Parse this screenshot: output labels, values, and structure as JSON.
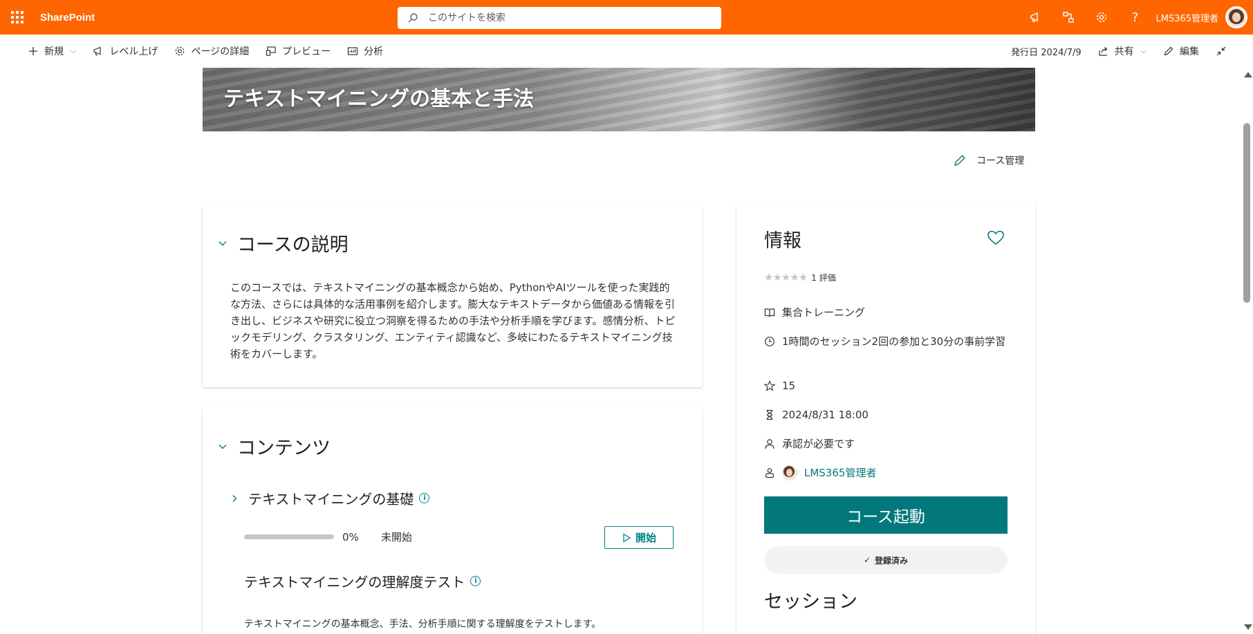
{
  "suitebar": {
    "brand": "SharePoint",
    "search_placeholder": "このサイトを検索",
    "user_name": "LMS365管理者"
  },
  "cmdbar": {
    "new": "新規",
    "promote": "レベル上げ",
    "page_details": "ページの詳細",
    "preview": "プレビュー",
    "analytics": "分析",
    "published": "発行日 2024/7/9",
    "share": "共有",
    "edit": "編集"
  },
  "hero": {
    "title": "テキストマイニングの基本と手法"
  },
  "course_manage": "コース管理",
  "description": {
    "heading": "コースの説明",
    "text": "このコースでは、テキストマイニングの基本概念から始め、PythonやAIツールを使った実践的な方法、さらには具体的な活用事例を紹介します。膨大なテキストデータから価値ある情報を引き出し、ビジネスや研究に役立つ洞察を得るための手法や分析手順を学びます。感情分析、トピックモデリング、クラスタリング、エンティティ認識など、多岐にわたるテキストマイニング技術をカバーします。"
  },
  "contents": {
    "heading": "コンテンツ",
    "modules": [
      {
        "title": "テキストマイニングの基礎",
        "progress_pct": 0,
        "progress_label": "0%",
        "status": "未開始",
        "start_label": "開始"
      },
      {
        "title": "テキストマイニングの理解度テスト",
        "description": "テキストマイニングの基本概念、手法、分析手順に関する理解度をテストします。"
      }
    ]
  },
  "info": {
    "heading": "情報",
    "rating_count": "1 評価",
    "rating_value": 0,
    "training_type": "集合トレーニング",
    "duration": "1時間のセッション2回の参加と30分の事前学習",
    "points": "15",
    "deadline": "2024/8/31 18:00",
    "approval": "承認が必要です",
    "owner": "LMS365管理者",
    "launch_label": "コース起動",
    "enrolled_label": "登録済み",
    "session_heading": "セッション"
  },
  "colors": {
    "suitebar": "#ff6600",
    "accent_teal": "#03787c"
  }
}
